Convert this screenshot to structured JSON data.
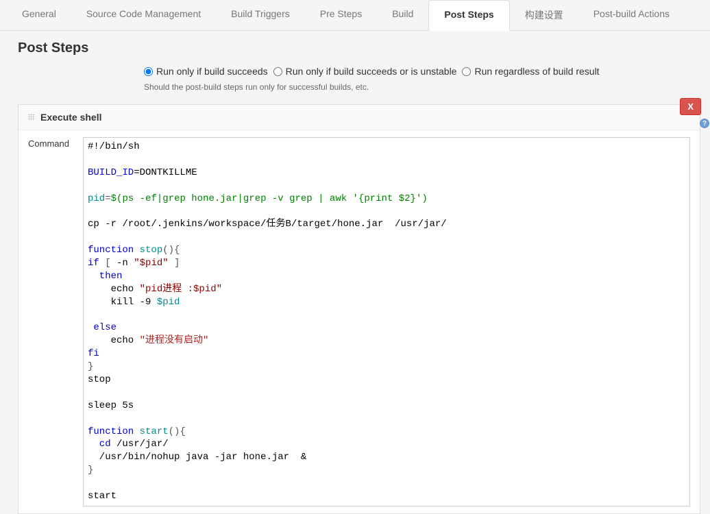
{
  "tabs": {
    "items": [
      {
        "label": "General"
      },
      {
        "label": "Source Code Management"
      },
      {
        "label": "Build Triggers"
      },
      {
        "label": "Pre Steps"
      },
      {
        "label": "Build"
      },
      {
        "label": "Post Steps"
      },
      {
        "label": "构建设置"
      },
      {
        "label": "Post-build Actions"
      }
    ]
  },
  "page": {
    "title": "Post Steps"
  },
  "radios": {
    "opt1": "Run only if build succeeds",
    "opt2": "Run only if build succeeds or is unstable",
    "opt3": "Run regardless of build result",
    "hint": "Should the post-build steps run only for successful builds, etc."
  },
  "step": {
    "header": "Execute shell",
    "close": "X",
    "help": "?",
    "commandLabel": "Command",
    "code": {
      "l01": "#!/bin/sh",
      "l02a": "BUILD_ID",
      "l02b": "=DONTKILLME",
      "l03a": "pid",
      "l03b": "=",
      "l03c": "$(",
      "l03d": "ps -ef",
      "l03e": "|",
      "l03f": "grep hone.jar",
      "l03g": "|",
      "l03h": "grep -v grep ",
      "l03i": "|",
      "l03j": " awk ",
      "l03k": "'{print $2}'",
      "l03l": ")",
      "l04": "cp -r /root/.jenkins/workspace/任务B/target/hone.jar  /usr/jar/",
      "l05a": "function",
      "l05b": " stop",
      "l05c": "(){",
      "l06a": "if ",
      "l06b": "[",
      "l06c": " -n ",
      "l06d": "\"$pid\"",
      "l06e": " ]",
      "l07": "  then",
      "l08a": "    echo ",
      "l08b": "\"pid进程 :$pid\"",
      "l09a": "    kill -9 ",
      "l09b": "$pid",
      "l10": " else",
      "l11a": "    echo ",
      "l11b": "\"进程没有启动\"",
      "l12": "fi",
      "l13": "}",
      "l14": "stop",
      "l15": "sleep 5s",
      "l16a": "function",
      "l16b": " start",
      "l16c": "(){",
      "l17a": "  cd",
      "l17b": " /usr/jar/",
      "l18": "  /usr/bin/nohup java -jar hone.jar  &",
      "l19": "}",
      "l20": "start"
    }
  }
}
